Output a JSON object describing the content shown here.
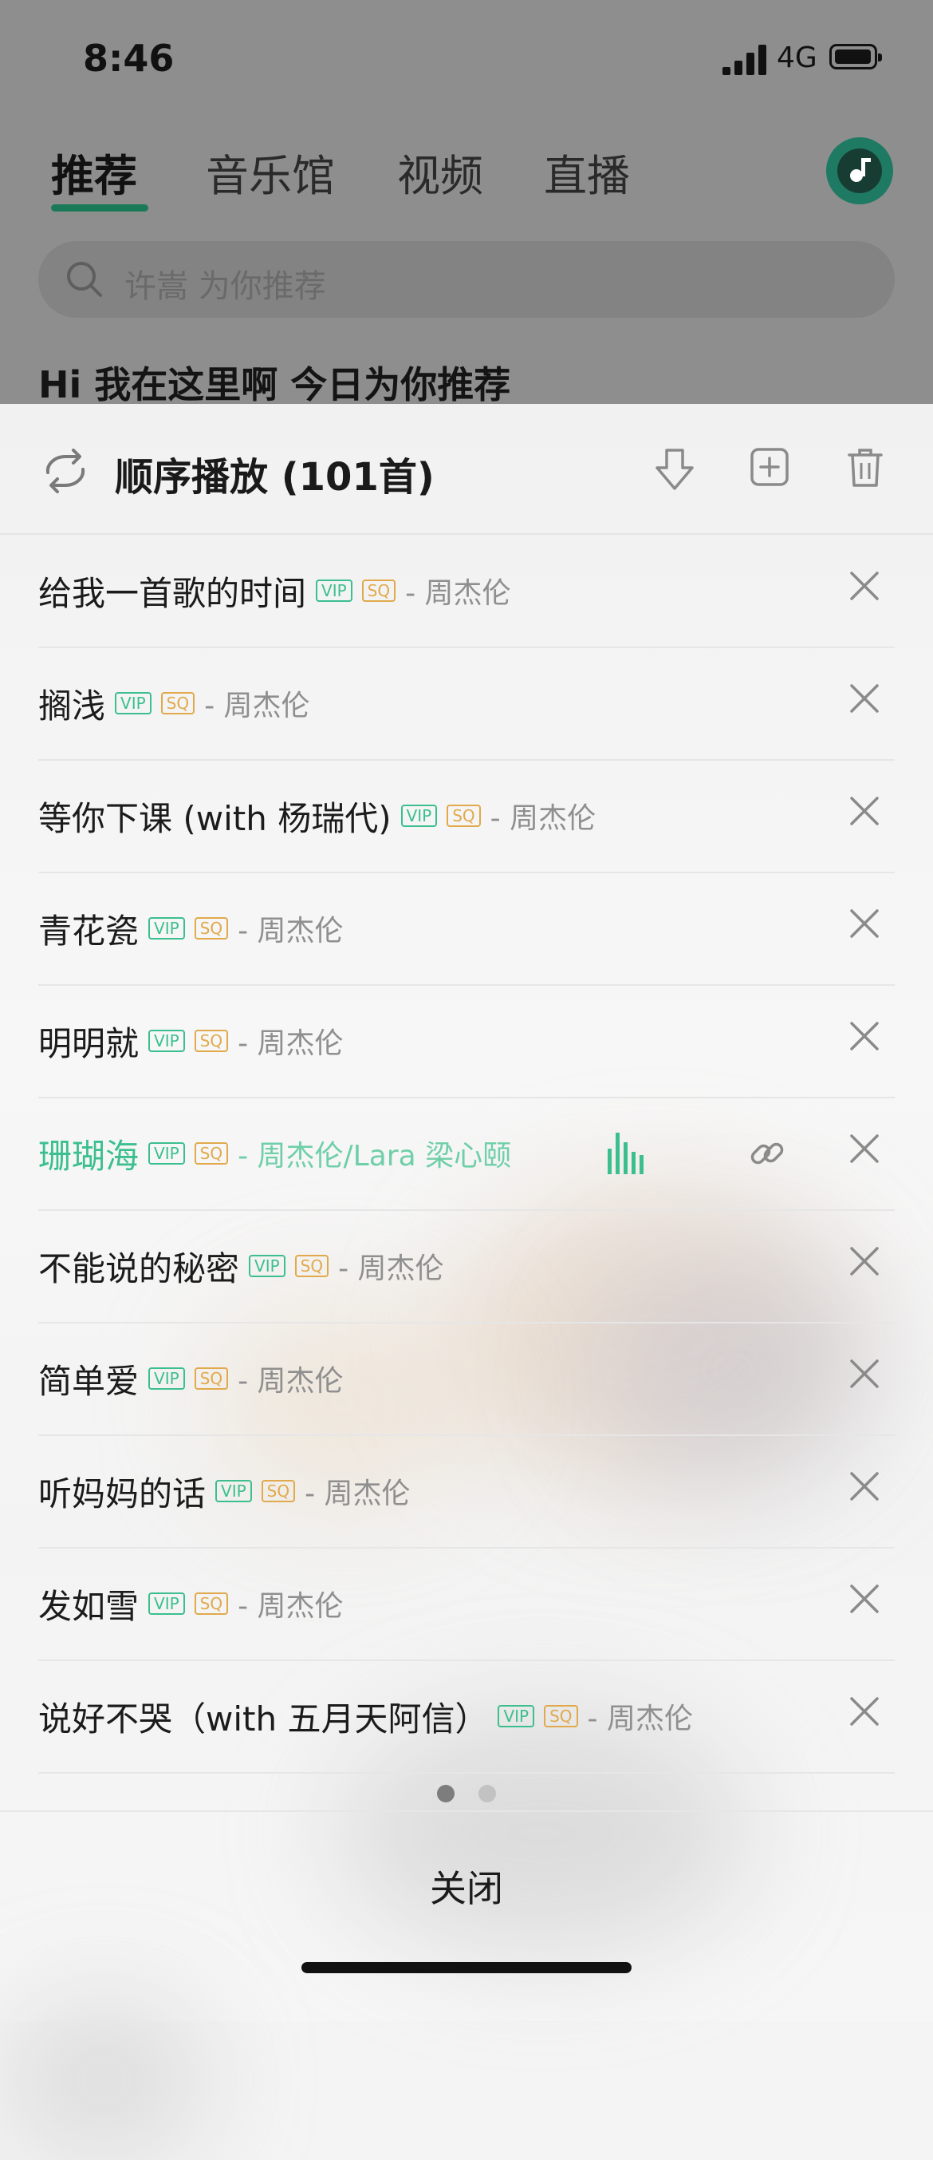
{
  "status": {
    "time": "8:46",
    "network": "4G"
  },
  "tabs": [
    "推荐",
    "音乐馆",
    "视频",
    "直播"
  ],
  "search": {
    "placeholder": "许嵩  为你推荐"
  },
  "greeting": "Hi 我在这里啊  今日为你推荐",
  "playlist": {
    "title": "顺序播放 (101首)",
    "mode_icon": "repeat-icon",
    "actions": [
      "download-icon",
      "add-to-icon",
      "trash-icon"
    ],
    "tag_vip": "VIP",
    "tag_sq": "SQ",
    "items": [
      {
        "title": "给我一首歌的时间",
        "artist": "- 周杰伦",
        "playing": false
      },
      {
        "title": "搁浅",
        "artist": "- 周杰伦",
        "playing": false
      },
      {
        "title": "等你下课 (with 杨瑞代)",
        "artist": "- 周杰伦",
        "playing": false
      },
      {
        "title": "青花瓷",
        "artist": "- 周杰伦",
        "playing": false
      },
      {
        "title": "明明就",
        "artist": "- 周杰伦",
        "playing": false
      },
      {
        "title": "珊瑚海",
        "artist": "- 周杰伦/Lara 梁心颐",
        "playing": true
      },
      {
        "title": "不能说的秘密",
        "artist": "- 周杰伦",
        "playing": false
      },
      {
        "title": "简单爱",
        "artist": "- 周杰伦",
        "playing": false
      },
      {
        "title": "听妈妈的话",
        "artist": "- 周杰伦",
        "playing": false
      },
      {
        "title": "发如雪",
        "artist": "- 周杰伦",
        "playing": false
      },
      {
        "title": "说好不哭（with 五月天阿信）",
        "artist": "- 周杰伦",
        "playing": false
      }
    ]
  },
  "pager": {
    "count": 2,
    "active": 1
  },
  "close_label": "关闭",
  "colors": {
    "accent": "#3cbf8f",
    "sq": "#e1a94c",
    "tab_underline": "#1a7a58"
  }
}
